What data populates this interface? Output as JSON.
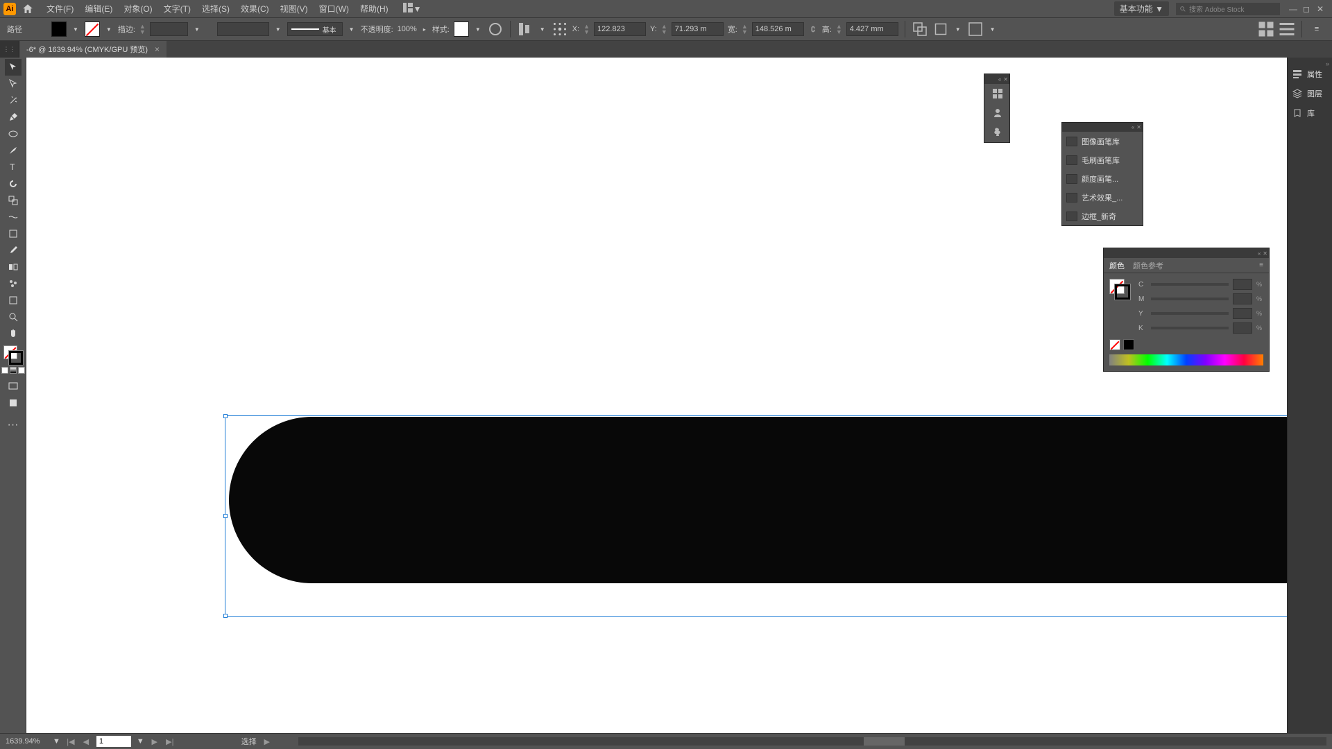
{
  "menubar": {
    "logo": "Ai",
    "items": [
      "文件(F)",
      "编辑(E)",
      "对象(O)",
      "文字(T)",
      "选择(S)",
      "效果(C)",
      "视图(V)",
      "窗口(W)",
      "帮助(H)"
    ],
    "workspace": "基本功能",
    "stock_placeholder": "搜索 Adobe Stock"
  },
  "controlbar": {
    "selection_type": "路径",
    "stroke_label": "描边:",
    "brush_label": "基本",
    "opacity_label": "不透明度:",
    "opacity_value": "100%",
    "style_label": "样式:",
    "x_label": "X:",
    "x_value": "122.823",
    "y_label": "Y:",
    "y_value": "71.293 m",
    "w_label": "宽:",
    "w_value": "148.526 m",
    "h_label": "高:",
    "h_value": "4.427 mm"
  },
  "tab": {
    "title": "-6* @ 1639.94% (CMYK/GPU 预览)"
  },
  "right_dock": {
    "items": [
      {
        "label": "属性",
        "icon": "properties"
      },
      {
        "label": "图层",
        "icon": "layers"
      },
      {
        "label": "库",
        "icon": "libraries"
      }
    ]
  },
  "brush_panel": {
    "items": [
      "图像画笔库",
      "毛刷画笔库",
      "颜度画笔...",
      "艺术效果_...",
      "边框_新奇"
    ]
  },
  "color_panel": {
    "tabs": [
      "颜色",
      "颜色参考"
    ],
    "channels": [
      "C",
      "M",
      "Y",
      "K"
    ],
    "pct": "%"
  },
  "statusbar": {
    "zoom": "1639.94%",
    "page": "1",
    "mode": "选择"
  }
}
